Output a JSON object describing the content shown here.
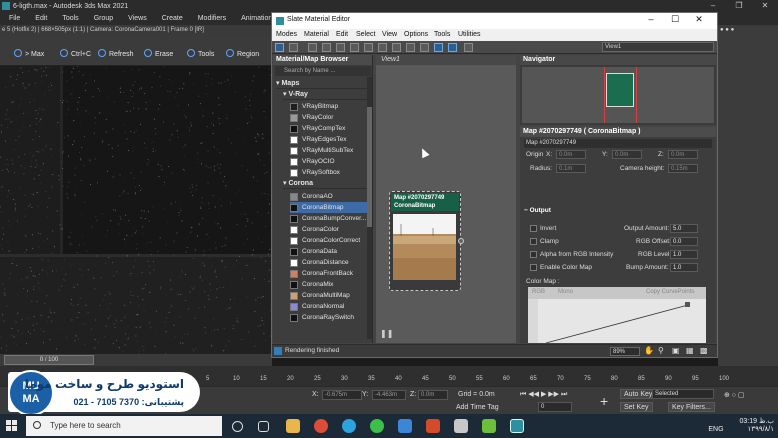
{
  "max_window": {
    "title": "6-ligth.max - Autodesk 3ds Max 2021",
    "menus": [
      "File",
      "Edit",
      "Tools",
      "Group",
      "Views",
      "Create",
      "Modifiers",
      "Animation"
    ],
    "vfb_info": "e 5 (Hotfix 2) | 668×505px (1:1) | Camera: CoronaCamera001 | Frame 0 [IR]",
    "vfb_tools": [
      "> Max",
      "Ctrl+C",
      "Refresh",
      "Erase",
      "Tools",
      "Region"
    ],
    "time_slider": "0 / 100",
    "track_ticks": [
      "5",
      "10",
      "15",
      "20",
      "25",
      "30",
      "35",
      "40",
      "45",
      "50",
      "55",
      "60",
      "65",
      "70",
      "75",
      "80",
      "85",
      "90",
      "95",
      "100"
    ],
    "status": {
      "x_label": "X:",
      "x_value": "-0.675m",
      "y_label": "Y:",
      "y_value": "-4.463m",
      "z_label": "Z:",
      "z_value": "0.0m",
      "grid": "Grid = 0.0m",
      "add_time_tag": "Add Time Tag",
      "auto_key": "Auto Key",
      "set_key": "Set Key",
      "selected": "Selected",
      "key_filters": "Key Filters...",
      "frame": "0"
    }
  },
  "slate": {
    "title": "Slate Material Editor",
    "menus": [
      "Modes",
      "Material",
      "Edit",
      "Select",
      "View",
      "Options",
      "Tools",
      "Utilities"
    ],
    "view_dropdown": "View1",
    "browser": {
      "title": "Material/Map Browser",
      "search_placeholder": "Search by Name ...",
      "maps_label": "Maps",
      "vray_group": "V-Ray",
      "vray_items": [
        "VRayBitmap",
        "VRayColor",
        "VRayCompTex",
        "VRayEdgesTex",
        "VRayMultiSubTex",
        "VRayOCIO",
        "VRaySoftbox"
      ],
      "corona_group": "Corona",
      "corona_items": [
        "CoronaAO",
        "CoronaBitmap",
        "CoronaBumpConver...",
        "CoronaColor",
        "CoronaColorCorrect",
        "CoronaData",
        "CoronaDistance",
        "CoronaFrontBack",
        "CoronaMix",
        "CoronaMultiMap",
        "CoronaNormal",
        "CoronaRaySwitch"
      ],
      "selected_item": "CoronaBitmap"
    },
    "view_tab": "View1",
    "node": {
      "line1": "Map #2070297749",
      "line2": "CoronaBitmap"
    },
    "navigator_title": "Navigator",
    "params": {
      "title": "Map #2070297749  ( CoronaBitmap )",
      "name": "Map #2070297749",
      "origin_label": "Origin",
      "x_label": "X:",
      "y_label": "Y:",
      "z_label": "Z:",
      "origin_x": "0.0m",
      "origin_y": "0.0m",
      "origin_z": "0.0m",
      "radius_label": "Radius:",
      "radius_value": "0.1m",
      "camera_height_label": "Camera height:",
      "camera_height_value": "0.15m",
      "output_title": "Output",
      "invert": "Invert",
      "clamp": "Clamp",
      "alpha_rgb": "Alpha from RGB Intensity",
      "enable_color_map": "Enable Color Map",
      "output_amount_label": "Output Amount:",
      "output_amount": "5.0",
      "rgb_offset_label": "RGB Offset:",
      "rgb_offset": "0.0",
      "rgb_level_label": "RGB Level:",
      "rgb_level": "1.0",
      "bump_amount_label": "Bump Amount:",
      "bump_amount": "1.0",
      "color_map_label": "Color Map :",
      "rgb_radio": "RGB",
      "mono_radio": "Mono",
      "copy_curvepoints": "Copy CurvePoints"
    },
    "status_text": "Rendering finished",
    "zoom": "89%"
  },
  "logo": {
    "mark_top": "MU",
    "mark_bottom": "MA",
    "title": "استودیو طرح و ساخت موما",
    "phone": "پشتیبانی: 7370 7105 - 021"
  },
  "taskbar": {
    "search_placeholder": "Type here to search",
    "lang": "ENG",
    "time": "03:19 ب.ظ",
    "date": "۱۳۹۹/۸/۱"
  },
  "colors": {
    "node_header": "#176047",
    "selected_item": "#3e6aa6",
    "taskbar": "#1c2a38",
    "logo_blue": "#1b5fa6"
  }
}
